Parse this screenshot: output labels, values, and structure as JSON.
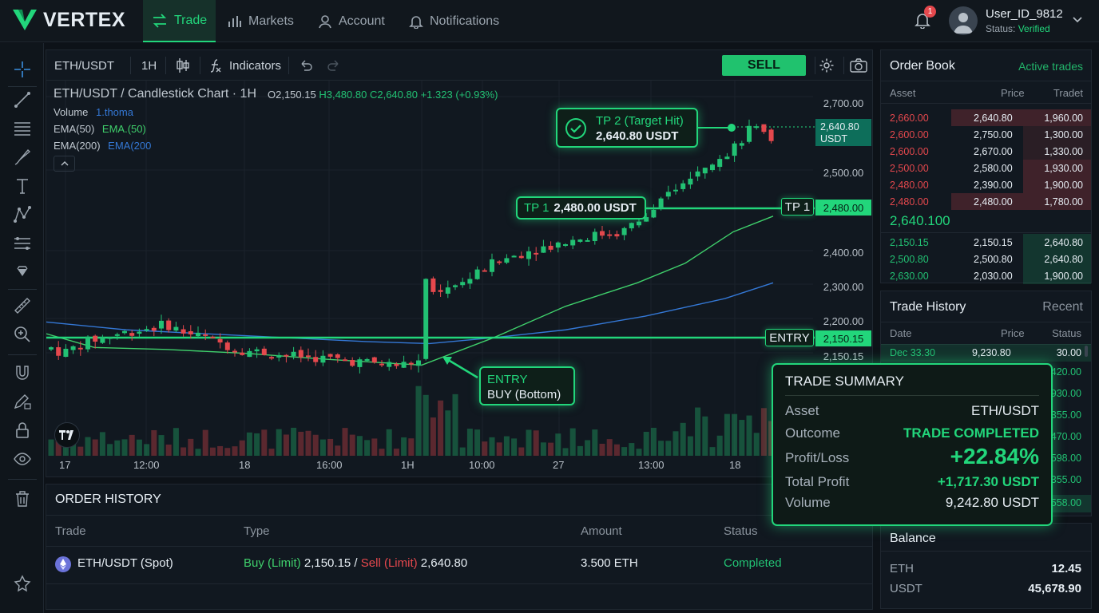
{
  "app": {
    "brand": "VERTEX"
  },
  "nav": [
    {
      "label": "Trade",
      "icon": "swap-arrows-icon",
      "active": true
    },
    {
      "label": "Markets",
      "icon": "bar-chart-icon",
      "active": false
    },
    {
      "label": "Account",
      "icon": "user-icon",
      "active": false
    },
    {
      "label": "Notifications",
      "icon": "bell-icon",
      "active": false
    }
  ],
  "user": {
    "name": "User_ID_9812",
    "status_label": "Status:",
    "status_value": "Verified",
    "notification_count": "1"
  },
  "toolbar": {
    "symbol": "ETH/USDT",
    "interval": "1H",
    "indicators_label": "Indicators",
    "sell_label": "SELL"
  },
  "chart_legend": {
    "title": "ETH/USDT / Candlestick Chart · 1H",
    "open": "O2,150.15",
    "high": "H3,480.80",
    "close": "C2,640.80",
    "change": "+1.323 (+0.93%)",
    "volume_label": "Volume",
    "volume_value": "1.thoma",
    "ema50_label": "EMA(50)",
    "ema50_value": "EMA.(50)",
    "ema200_label": "EMA(200)",
    "ema200_value": "EMA(200"
  },
  "chart_data": {
    "type": "candlestick",
    "price_axis_ticks": [
      "2,700.00",
      "2,500.00",
      "2,400.00",
      "2,300.00",
      "2,200.00",
      "2,150.15"
    ],
    "time_axis_ticks": [
      "17",
      "12:00",
      "18",
      "16:00",
      "1H",
      "10:00",
      "27",
      "13:00",
      "18"
    ],
    "current_price_tag": [
      "2,640.80",
      "USDT"
    ],
    "tp1_price_tag": "2,480.00",
    "entry_price_tag": "2,150.15",
    "levels": {
      "entry": 2150.15,
      "tp1": 2480.0,
      "tp2": 2640.8
    },
    "annotations": {
      "tp2_title": "TP 2 (Target Hit)",
      "tp2_value": "2,640.80 USDT",
      "tp1_label": "TP 1",
      "tp1_value": "2,480.00 USDT",
      "tp1_tag": "TP 1",
      "entry_tag": "ENTRY",
      "entry_title": "ENTRY",
      "entry_sub": "BUY (Bottom)"
    },
    "colors": {
      "up": "#22c173",
      "down": "#e5484d",
      "ema50": "#3fcf6b",
      "ema200": "#3478d6",
      "accent": "#22d67b"
    }
  },
  "order_history": {
    "title": "ORDER HISTORY",
    "columns": [
      "Trade",
      "Type",
      "Amount",
      "Status"
    ],
    "rows": [
      {
        "trade": "ETH/USDT (Spot)",
        "buy_label": "Buy (Limit)",
        "buy_price": "2,150.15 /",
        "sell_label": "Sell (Limit)",
        "sell_price": "2,640.80",
        "amount": "3.500 ETH",
        "status": "Completed"
      }
    ]
  },
  "order_book": {
    "title": "Order Book",
    "link": "Active trades",
    "columns": [
      "Asset",
      "Price",
      "Tradet"
    ],
    "asks": [
      [
        "2,660.00",
        "2,640.80",
        "1,960.00"
      ],
      [
        "2,600.00",
        "2,750.00",
        "1,300.00"
      ],
      [
        "2,600.00",
        "2,670.00",
        "1,330.00"
      ],
      [
        "2,500.00",
        "2,580.00",
        "1,930.00"
      ],
      [
        "2,480.00",
        "2,390.00",
        "1,900.00"
      ],
      [
        "2,480.00",
        "2,480.00",
        "1,780.00"
      ]
    ],
    "mid_price": "2,640.100",
    "bids": [
      [
        "2,150.15",
        "2,150.15",
        "2,640.80"
      ],
      [
        "2,500.80",
        "2,500.80",
        "2,640.80"
      ],
      [
        "2,630.00",
        "2,030.00",
        "1,900.00"
      ]
    ]
  },
  "trade_history": {
    "title": "Trade History",
    "link": "Recent",
    "columns": [
      "Date",
      "Price",
      "Status"
    ],
    "rows": [
      [
        "Dec  33.30",
        "9,230.80",
        "30.00"
      ]
    ],
    "partial_status": [
      "420.00",
      "930.00",
      "355.00",
      "470.00",
      "598.00",
      "355.00",
      "558.00"
    ]
  },
  "trade_summary": {
    "title": "TRADE SUMMARY",
    "rows": [
      {
        "label": "Asset",
        "value": "ETH/USDT"
      },
      {
        "label": "Outcome",
        "value": "TRADE COMPLETED"
      },
      {
        "label": "Profit/Loss",
        "value": "+22.84%"
      },
      {
        "label": "Total Profit",
        "value": "+1,717.30 USDT"
      },
      {
        "label": "Volume",
        "value": "9,242.80 USDT"
      }
    ]
  },
  "balance": {
    "title": "Balance",
    "rows": [
      {
        "asset": "ETH",
        "amount": "12.45"
      },
      {
        "asset": "USDT",
        "amount": "45,678.90"
      }
    ]
  }
}
